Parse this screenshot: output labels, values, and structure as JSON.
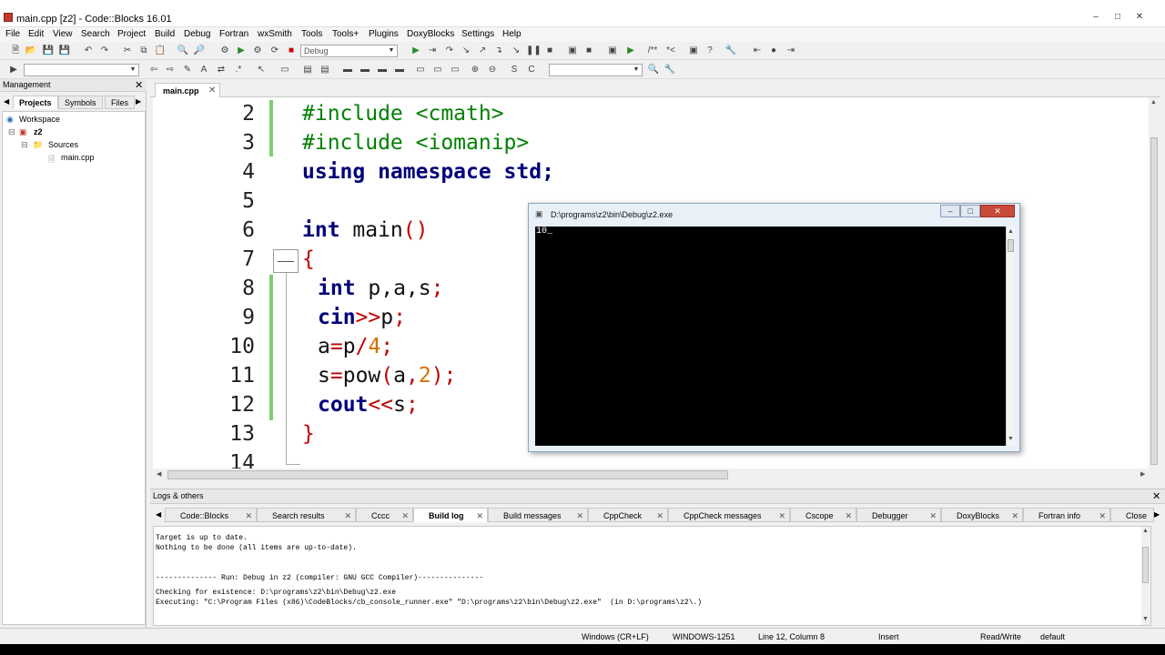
{
  "window": {
    "title": "main.cpp [z2] - Code::Blocks 16.01",
    "min_icon": "minimize-icon",
    "max_icon": "maximize-icon",
    "close_icon": "close-icon"
  },
  "menu": [
    "File",
    "Edit",
    "View",
    "Search",
    "Project",
    "Build",
    "Debug",
    "Fortran",
    "wxSmith",
    "Tools",
    "Tools+",
    "Plugins",
    "DoxyBlocks",
    "Settings",
    "Help"
  ],
  "toolbar": {
    "build_target": "Debug"
  },
  "management": {
    "title": "Management",
    "tabs": [
      "Projects",
      "Symbols",
      "Files"
    ],
    "tree": {
      "workspace": "Workspace",
      "project": "z2",
      "folder": "Sources",
      "file": "main.cpp"
    }
  },
  "editor": {
    "tab_label": "main.cpp",
    "line_numbers": [
      "2",
      "3",
      "4",
      "5",
      "6",
      "7",
      "8",
      "9",
      "10",
      "11",
      "12",
      "13",
      "14"
    ]
  },
  "console": {
    "title": "D:\\programs\\z2\\bin\\Debug\\z2.exe",
    "output": "10_"
  },
  "logs": {
    "title": "Logs & others",
    "tabs": [
      "Code::Blocks",
      "Search results",
      "Cccc",
      "Build log",
      "Build messages",
      "CppCheck",
      "CppCheck messages",
      "Cscope",
      "Debugger",
      "DoxyBlocks",
      "Fortran info",
      "Close"
    ],
    "active_tab": "Build log",
    "lines": [
      "Target is up to date.",
      "Nothing to be done (all items are up-to-date).",
      "",
      "",
      "-------------- Run: Debug in z2 (compiler: GNU GCC Compiler)---------------",
      "",
      "Checking for existence: D:\\programs\\z2\\bin\\Debug\\z2.exe",
      "Executing: \"C:\\Program Files (x86)\\CodeBlocks/cb_console_runner.exe\" \"D:\\programs\\z2\\bin\\Debug\\z2.exe\"  (in D:\\programs\\z2\\.)"
    ]
  },
  "status": {
    "line_endings": "Windows (CR+LF)",
    "encoding": "WINDOWS-1251",
    "position": "Line 12, Column 8",
    "mode": "Insert",
    "access": "Read/Write",
    "profile": "default"
  },
  "colors": {
    "keyword": "#00007a",
    "preprocessor": "#008000",
    "operator": "#c00000",
    "number": "#d07000",
    "changebar": "#7ccf6e"
  }
}
